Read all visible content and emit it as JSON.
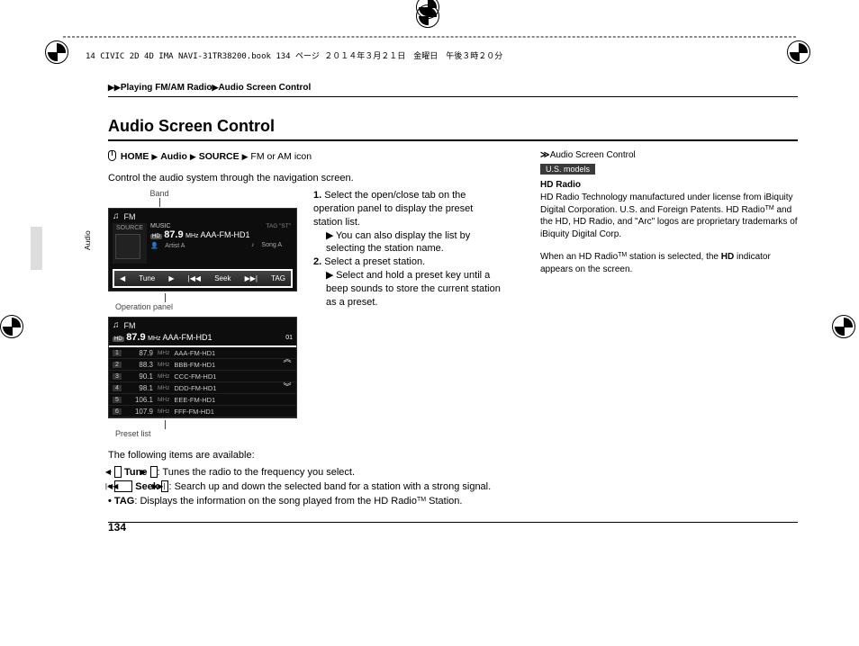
{
  "header_info": "14 CIVIC 2D 4D IMA NAVI-31TR38200.book  134 ページ  ２０１４年３月２１日　金曜日　午後３時２０分",
  "breadcrumb": {
    "seg1": "Playing FM/AM Radio",
    "seg2": "Audio Screen Control"
  },
  "title": "Audio Screen Control",
  "navpath": {
    "home": "HOME",
    "audio": "Audio",
    "source": "SOURCE",
    "last": "FM or AM icon"
  },
  "intro": "Control the audio system through the navigation screen.",
  "labels": {
    "band": "Band",
    "op_panel": "Operation panel",
    "preset": "Preset list"
  },
  "screen1": {
    "band": "FM",
    "source_btn": "SOURCE",
    "music": "MUSIC",
    "hd": "HD",
    "tag_st": "TAG \"ST\"",
    "freq_num": "87.9",
    "freq_unit": "MHz",
    "station": "AAA-FM-HD1",
    "artist_icon_label": "Artist A",
    "song_icon_label": "Song A",
    "tune": "Tune",
    "seek": "Seek",
    "tag": "TAG"
  },
  "screen2": {
    "band": "FM",
    "hd": "HD",
    "freq_num": "87.9",
    "freq_unit": "MHz",
    "station": "AAA-FM-HD1",
    "side_num": "01",
    "rows": [
      {
        "n": "1",
        "f": "87.9",
        "u": "MHz",
        "s": "AAA-FM-HD1"
      },
      {
        "n": "2",
        "f": "88.3",
        "u": "MHz",
        "s": "BBB-FM-HD1"
      },
      {
        "n": "3",
        "f": "90.1",
        "u": "MHz",
        "s": "CCC-FM-HD1"
      },
      {
        "n": "4",
        "f": "98.1",
        "u": "MHz",
        "s": "DDD-FM-HD1"
      },
      {
        "n": "5",
        "f": "106.1",
        "u": "MHz",
        "s": "EEE-FM-HD1"
      },
      {
        "n": "6",
        "f": "107.9",
        "u": "MHz",
        "s": "FFF-FM-HD1"
      }
    ]
  },
  "steps": {
    "s1": "Select the open/close tab on the operation panel to display the preset station list.",
    "s1b": "You can also display the list by selecting the station name.",
    "s2": "Select a preset station.",
    "s2b": "Select and hold a preset key until a beep sounds to store the current station as a preset."
  },
  "para2": "The following items are available:",
  "bullets": {
    "tune_l": "Tune",
    "tune_d": ": Tunes the radio to the frequency you select.",
    "seek_l": "Seek",
    "seek_d": ": Search up and down the selected band for a station with a strong signal.",
    "tag_l": "TAG",
    "tag_d_a": ": Displays the information on the song played from the HD Radio",
    "tag_d_b": " Station."
  },
  "side": {
    "head": "Audio Screen Control",
    "badge": "U.S. models",
    "hd": "HD Radio",
    "p1a": "HD Radio Technology manufactured under license from iBiquity Digital Corporation. U.S. and Foreign Patents. HD Radio",
    "p1b": " and the HD, HD Radio, and \"Arc\" logos are proprietary trademarks of iBiquity Digital Corp.",
    "p2a": "When an HD Radio",
    "p2b": " station is selected, the ",
    "p2c": "HD",
    "p2d": " indicator appears on the screen."
  },
  "page_num": "134",
  "side_label": "Audio"
}
